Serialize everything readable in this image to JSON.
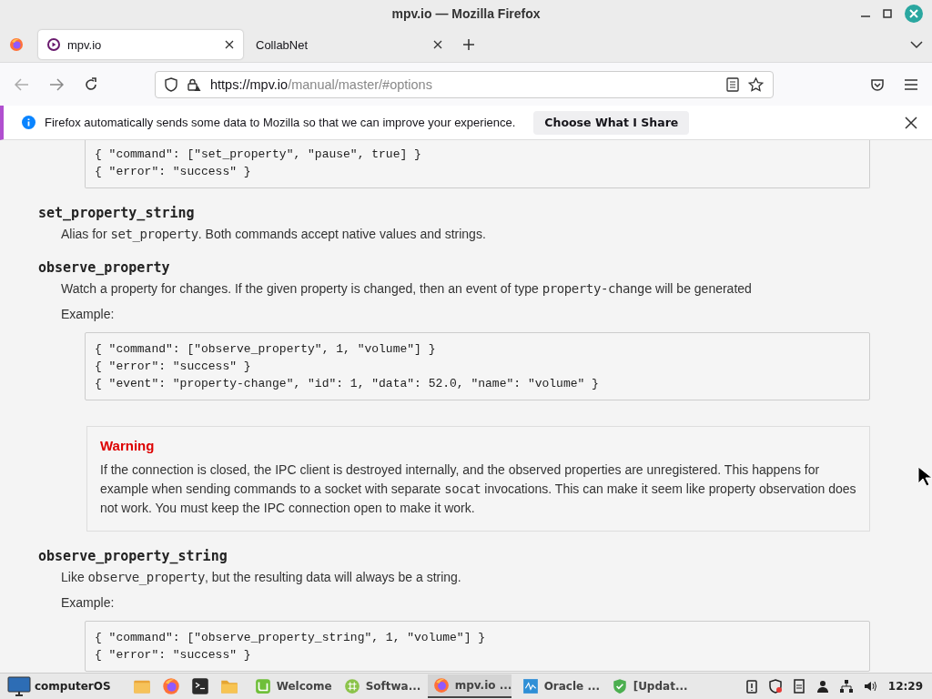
{
  "window": {
    "title": "mpv.io — Mozilla Firefox"
  },
  "tabs": [
    {
      "label": "mpv.io",
      "selected": true
    },
    {
      "label": "CollabNet",
      "selected": false
    }
  ],
  "navigation": {
    "back_disabled": true,
    "url_host": "https://mpv.io",
    "url_path": "/manual/master/#options"
  },
  "notification": {
    "message": "Firefox automatically sends some data to Mozilla so that we can improve your experience.",
    "button": "Choose What I Share"
  },
  "content": [
    {
      "kind": "code",
      "lines": [
        "{ \"command\": [\"set_property\", \"pause\", true] }",
        "{ \"error\": \"success\" }"
      ]
    },
    {
      "kind": "heading",
      "text": "set_property_string"
    },
    {
      "kind": "para",
      "parts": [
        {
          "kind": "text",
          "text": "Alias for "
        },
        {
          "kind": "code",
          "text": "set_property"
        },
        {
          "kind": "text",
          "text": ". Both commands accept native values and strings."
        }
      ]
    },
    {
      "kind": "heading",
      "text": "observe_property"
    },
    {
      "kind": "para",
      "parts": [
        {
          "kind": "text",
          "text": "Watch a property for changes. If the given property is changed, then an event of type "
        },
        {
          "kind": "code",
          "text": "property-change"
        },
        {
          "kind": "text",
          "text": " will be generated"
        }
      ]
    },
    {
      "kind": "label",
      "text": "Example:"
    },
    {
      "kind": "code",
      "lines": [
        "{ \"command\": [\"observe_property\", 1, \"volume\"] }",
        "{ \"error\": \"success\" }",
        "{ \"event\": \"property-change\", \"id\": 1, \"data\": 52.0, \"name\": \"volume\" }"
      ]
    },
    {
      "kind": "warning",
      "title": "Warning",
      "parts": [
        {
          "kind": "text",
          "text": "If the connection is closed, the IPC client is destroyed internally, and the observed properties are unregistered. This happens for example when sending commands to a socket with separate "
        },
        {
          "kind": "code",
          "text": "socat"
        },
        {
          "kind": "text",
          "text": " invocations. This can make it seem like property observation does not work. You must keep the IPC connection open to make it work."
        }
      ]
    },
    {
      "kind": "heading",
      "text": "observe_property_string"
    },
    {
      "kind": "para",
      "parts": [
        {
          "kind": "text",
          "text": "Like "
        },
        {
          "kind": "code",
          "text": "observe_property"
        },
        {
          "kind": "text",
          "text": ", but the resulting data will always be a string."
        }
      ]
    },
    {
      "kind": "label",
      "text": "Example:"
    },
    {
      "kind": "code",
      "lines": [
        "{ \"command\": [\"observe_property_string\", 1, \"volume\"] }",
        "{ \"error\": \"success\" }"
      ]
    }
  ],
  "taskbar": {
    "start": "computerOS",
    "launchers": [
      {
        "kind": "files"
      },
      {
        "kind": "firefox"
      },
      {
        "kind": "terminal"
      },
      {
        "kind": "folder"
      }
    ],
    "windows": [
      {
        "kind": "welcome",
        "label": "Welcome",
        "selected": false
      },
      {
        "kind": "software",
        "label": "Softwa...",
        "selected": false
      },
      {
        "kind": "firefox",
        "label": "mpv.io ...",
        "selected": true
      },
      {
        "kind": "monitor",
        "label": "Oracle ...",
        "selected": false
      },
      {
        "kind": "shield",
        "label": "[Updat...",
        "selected": false
      }
    ],
    "tray": [
      {
        "kind": "clipboard"
      },
      {
        "kind": "shield"
      },
      {
        "kind": "notes"
      },
      {
        "kind": "user"
      },
      {
        "kind": "network"
      },
      {
        "kind": "volume"
      }
    ],
    "clock": "12:29"
  }
}
